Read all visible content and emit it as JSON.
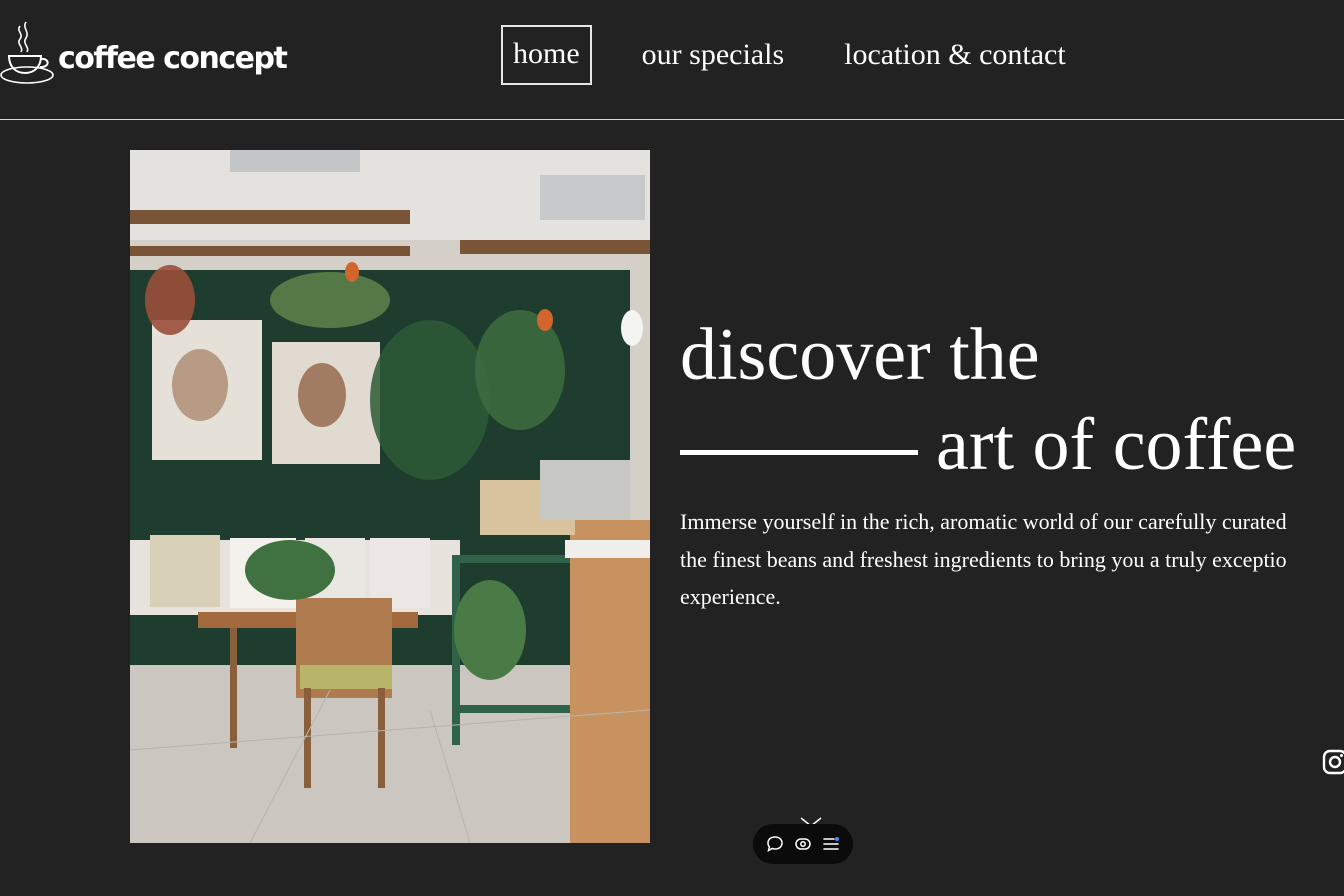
{
  "brand": {
    "name": "coffee concept"
  },
  "nav": {
    "home": "home",
    "specials": "our specials",
    "contact": "location & contact"
  },
  "hero": {
    "title_line1": "discover the",
    "title_line2": "art of coffee",
    "description_lines": [
      "Immerse yourself in the rich, aromatic world of our carefully curated",
      "the finest beans and freshest ingredients to bring you a truly exceptio",
      "experience."
    ]
  },
  "social": {
    "icon": "instagram-icon"
  },
  "toolbar": {
    "icons": [
      "comment-icon",
      "eye-icon",
      "menu-icon"
    ]
  },
  "colors": {
    "background": "#222222",
    "text": "#ffffff",
    "divider": "#d9d9d9",
    "toolbar": "#0b0b0b",
    "accent": "#4a8cff"
  }
}
